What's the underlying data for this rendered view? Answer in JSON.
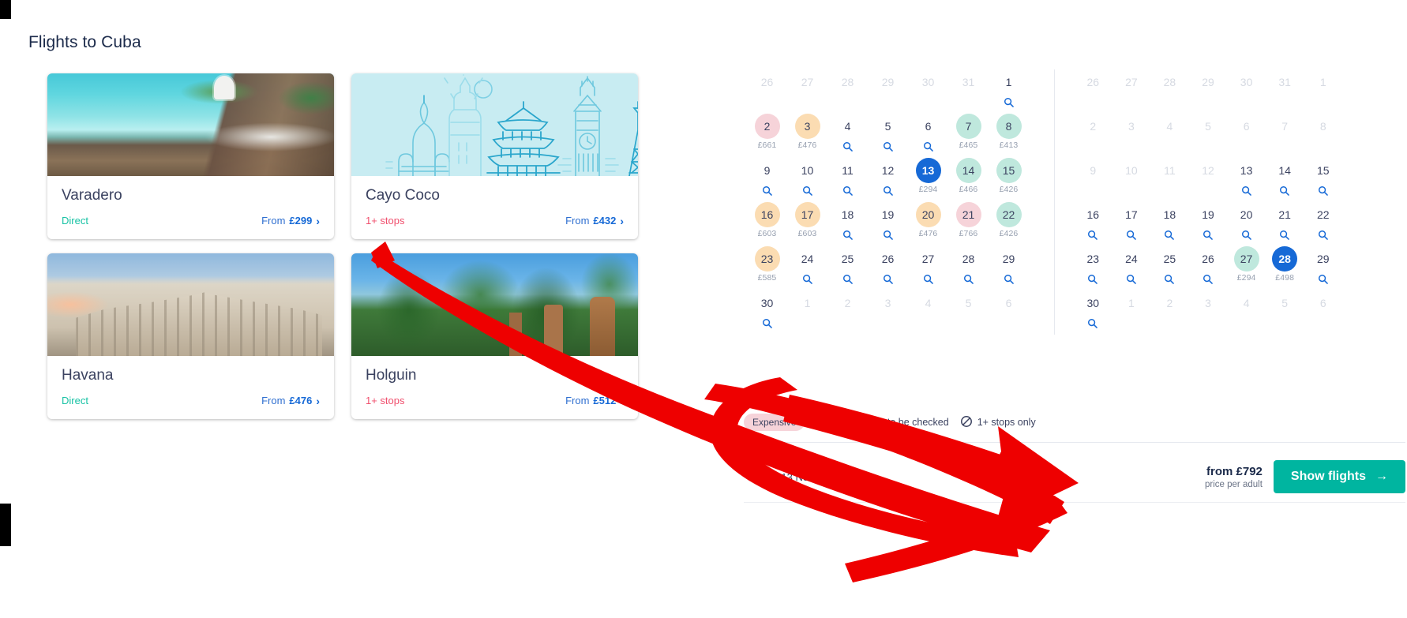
{
  "page": {
    "title": "Flights to Cuba"
  },
  "destinations": [
    {
      "city": "Varadero",
      "stops": "Direct",
      "stops_type": "direct",
      "from_label": "From",
      "price": "£299",
      "image": "varadero-beach-photo",
      "chevron": "›"
    },
    {
      "city": "Cayo Coco",
      "stops": "1+ stops",
      "stops_type": "multi",
      "from_label": "From",
      "price": "£432",
      "image": "landmarks-placeholder-illustration",
      "chevron": "›"
    },
    {
      "city": "Havana",
      "stops": "Direct",
      "stops_type": "direct",
      "from_label": "From",
      "price": "£476",
      "image": "havana-gran-teatro-photo",
      "chevron": "›"
    },
    {
      "city": "Holguin",
      "stops": "1+ stops",
      "stops_type": "multi",
      "from_label": "From",
      "price": "£512",
      "image": "holguin-palms-photo",
      "chevron": "›"
    }
  ],
  "calendar": {
    "months": [
      {
        "name": "left-month",
        "weeks": [
          [
            {
              "num": "26",
              "muted": true
            },
            {
              "num": "27",
              "muted": true
            },
            {
              "num": "28",
              "muted": true
            },
            {
              "num": "29",
              "muted": true
            },
            {
              "num": "30",
              "muted": true
            },
            {
              "num": "31",
              "muted": true
            },
            {
              "num": "1",
              "search": true
            }
          ],
          [
            {
              "num": "2",
              "price": "£661",
              "tier": "exp"
            },
            {
              "num": "3",
              "price": "£476",
              "tier": "mid"
            },
            {
              "num": "4",
              "search": true
            },
            {
              "num": "5",
              "search": true
            },
            {
              "num": "6",
              "search": true
            },
            {
              "num": "7",
              "price": "£465",
              "tier": "cheap"
            },
            {
              "num": "8",
              "price": "£413",
              "tier": "cheap"
            }
          ],
          [
            {
              "num": "9",
              "search": true
            },
            {
              "num": "10",
              "search": true
            },
            {
              "num": "11",
              "search": true
            },
            {
              "num": "12",
              "search": true
            },
            {
              "num": "13",
              "price": "£294",
              "selected": true
            },
            {
              "num": "14",
              "price": "£466",
              "tier": "cheap"
            },
            {
              "num": "15",
              "price": "£426",
              "tier": "cheap"
            }
          ],
          [
            {
              "num": "16",
              "price": "£603",
              "tier": "mid"
            },
            {
              "num": "17",
              "price": "£603",
              "tier": "mid"
            },
            {
              "num": "18",
              "search": true
            },
            {
              "num": "19",
              "search": true
            },
            {
              "num": "20",
              "price": "£476",
              "tier": "mid"
            },
            {
              "num": "21",
              "price": "£766",
              "tier": "exp"
            },
            {
              "num": "22",
              "price": "£426",
              "tier": "cheap"
            }
          ],
          [
            {
              "num": "23",
              "price": "£585",
              "tier": "mid"
            },
            {
              "num": "24",
              "search": true
            },
            {
              "num": "25",
              "search": true
            },
            {
              "num": "26",
              "search": true
            },
            {
              "num": "27",
              "search": true
            },
            {
              "num": "28",
              "search": true
            },
            {
              "num": "29",
              "search": true
            }
          ],
          [
            {
              "num": "30",
              "search": true
            },
            {
              "num": "1",
              "muted": true
            },
            {
              "num": "2",
              "muted": true
            },
            {
              "num": "3",
              "muted": true
            },
            {
              "num": "4",
              "muted": true
            },
            {
              "num": "5",
              "muted": true
            },
            {
              "num": "6",
              "muted": true
            }
          ]
        ]
      },
      {
        "name": "right-month",
        "weeks": [
          [
            {
              "num": "26",
              "muted": true
            },
            {
              "num": "27",
              "muted": true
            },
            {
              "num": "28",
              "muted": true
            },
            {
              "num": "29",
              "muted": true
            },
            {
              "num": "30",
              "muted": true
            },
            {
              "num": "31",
              "muted": true
            },
            {
              "num": "1",
              "muted": true
            }
          ],
          [
            {
              "num": "2",
              "muted": true
            },
            {
              "num": "3",
              "muted": true
            },
            {
              "num": "4",
              "muted": true
            },
            {
              "num": "5",
              "muted": true
            },
            {
              "num": "6",
              "muted": true
            },
            {
              "num": "7",
              "muted": true
            },
            {
              "num": "8",
              "muted": true
            }
          ],
          [
            {
              "num": "9",
              "muted": true
            },
            {
              "num": "10",
              "muted": true
            },
            {
              "num": "11",
              "muted": true
            },
            {
              "num": "12",
              "muted": true
            },
            {
              "num": "13",
              "search": true
            },
            {
              "num": "14",
              "search": true
            },
            {
              "num": "15",
              "search": true
            }
          ],
          [
            {
              "num": "16",
              "search": true
            },
            {
              "num": "17",
              "search": true
            },
            {
              "num": "18",
              "search": true
            },
            {
              "num": "19",
              "search": true
            },
            {
              "num": "20",
              "search": true
            },
            {
              "num": "21",
              "search": true
            },
            {
              "num": "22",
              "search": true
            }
          ],
          [
            {
              "num": "23",
              "search": true
            },
            {
              "num": "24",
              "search": true
            },
            {
              "num": "25",
              "search": true
            },
            {
              "num": "26",
              "search": true
            },
            {
              "num": "27",
              "price": "£294",
              "tier": "cheap"
            },
            {
              "num": "28",
              "price": "£498",
              "selected": true
            },
            {
              "num": "29",
              "search": true
            }
          ],
          [
            {
              "num": "30",
              "search": true
            },
            {
              "num": "1",
              "muted": true
            },
            {
              "num": "2",
              "muted": true
            },
            {
              "num": "3",
              "muted": true
            },
            {
              "num": "4",
              "muted": true
            },
            {
              "num": "5",
              "muted": true
            },
            {
              "num": "6",
              "muted": true
            }
          ]
        ]
      }
    ],
    "legend": {
      "expensive": "Expensive",
      "price_check": "Price needs to be checked",
      "stops_only": "1+ stops only"
    },
    "footer": {
      "leg_date": "Fri, 13 Nov",
      "price_from": "from £792",
      "price_sub": "price per adult",
      "cta": "Show flights",
      "cta_arrow": "→"
    }
  },
  "colors": {
    "brand_blue": "#1669d6",
    "teal_cta": "#00b5a0",
    "direct_green": "#17c2a4",
    "stops_red": "#f0506e",
    "cheap": "#bfe8dd",
    "mid": "#fbdcb2",
    "expensive": "#f6d3d9",
    "annotation_red": "#ee0000"
  },
  "annotation": {
    "type": "red-arrow-overlay",
    "description": "hand-drawn red arrow pointing to Show flights button"
  }
}
